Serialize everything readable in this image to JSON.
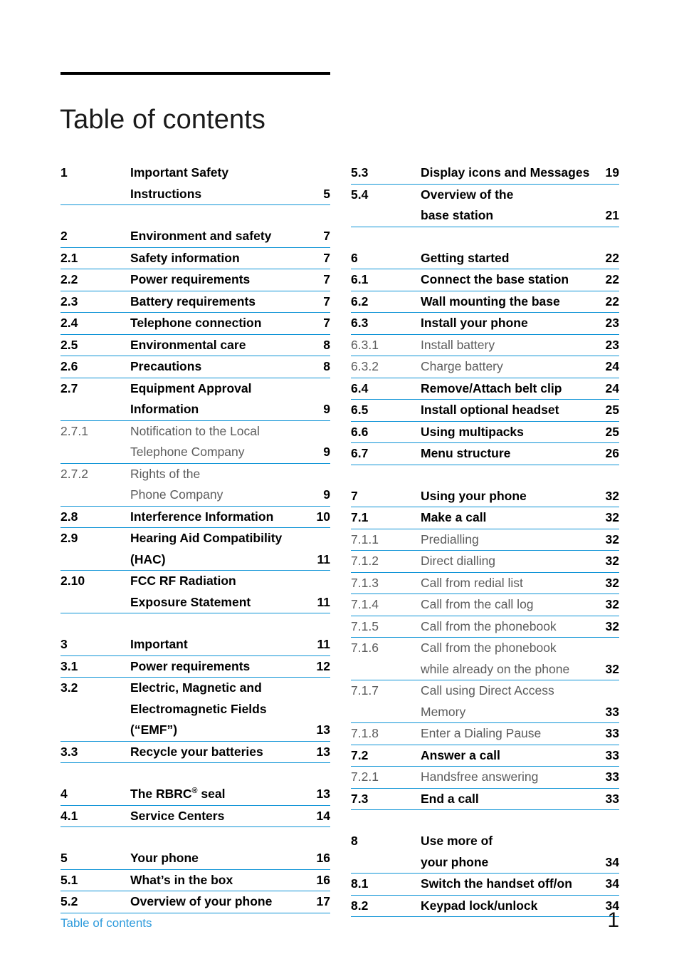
{
  "header": {
    "title": "Table of contents"
  },
  "footer": {
    "label": "Table of contents",
    "page_number": "1"
  },
  "colors": {
    "rule_blue": "#0d93d6",
    "footer_blue": "#2e9bdc",
    "level3_gray": "#5c5c5c",
    "header_rule": "#000000"
  },
  "columns": {
    "left": [
      {
        "group": 1,
        "entries": [
          {
            "level": 1,
            "number": "1",
            "lines": [
              "Important Safety",
              "Instructions"
            ],
            "page": "5"
          }
        ]
      },
      {
        "group": 2,
        "entries": [
          {
            "level": 1,
            "number": "2",
            "lines": [
              "Environment and safety"
            ],
            "page": "7",
            "tight": true
          },
          {
            "level": 2,
            "number": "2.1",
            "lines": [
              "Safety information"
            ],
            "page": "7"
          },
          {
            "level": 2,
            "number": "2.2",
            "lines": [
              "Power requirements"
            ],
            "page": "7"
          },
          {
            "level": 2,
            "number": "2.3",
            "lines": [
              "Battery requirements"
            ],
            "page": "7"
          },
          {
            "level": 2,
            "number": "2.4",
            "lines": [
              "Telephone connection"
            ],
            "page": "7"
          },
          {
            "level": 2,
            "number": "2.5",
            "lines": [
              "Environmental care"
            ],
            "page": "8"
          },
          {
            "level": 2,
            "number": "2.6",
            "lines": [
              "Precautions"
            ],
            "page": "8"
          },
          {
            "level": 2,
            "number": "2.7",
            "lines": [
              "Equipment Approval",
              "Information"
            ],
            "page": "9"
          },
          {
            "level": 3,
            "number": "2.7.1",
            "lines": [
              "Notification to the Local",
              "Telephone Company"
            ],
            "page": "9"
          },
          {
            "level": 3,
            "number": "2.7.2",
            "lines": [
              "Rights of the",
              "Phone Company"
            ],
            "page": "9"
          },
          {
            "level": 2,
            "number": "2.8",
            "lines": [
              "Interference Information"
            ],
            "page": "10"
          },
          {
            "level": 2,
            "number": "2.9",
            "lines": [
              "Hearing Aid Compatibility",
              "(HAC)"
            ],
            "page": "11"
          },
          {
            "level": 2,
            "number": "2.10",
            "lines": [
              "FCC RF Radiation",
              "Exposure Statement"
            ],
            "page": "11"
          }
        ]
      },
      {
        "group": 3,
        "entries": [
          {
            "level": 1,
            "number": "3",
            "lines": [
              "Important"
            ],
            "page": "11"
          },
          {
            "level": 2,
            "number": "3.1",
            "lines": [
              "Power requirements"
            ],
            "page": "12"
          },
          {
            "level": 2,
            "number": "3.2",
            "lines": [
              "Electric, Magnetic and",
              "Electromagnetic Fields",
              "(“EMF”)"
            ],
            "page": "13"
          },
          {
            "level": 2,
            "number": "3.3",
            "lines": [
              "Recycle your batteries"
            ],
            "page": "13"
          }
        ]
      },
      {
        "group": 4,
        "entries": [
          {
            "level": 1,
            "number": "4",
            "lines": [
              "The RBRC® seal"
            ],
            "page": "13",
            "has_sup": true
          },
          {
            "level": 2,
            "number": "4.1",
            "lines": [
              "Service Centers"
            ],
            "page": "14"
          }
        ]
      },
      {
        "group": 5,
        "entries": [
          {
            "level": 1,
            "number": "5",
            "lines": [
              "Your phone"
            ],
            "page": "16"
          },
          {
            "level": 2,
            "number": "5.1",
            "lines": [
              "What’s in the box"
            ],
            "page": "16"
          },
          {
            "level": 2,
            "number": "5.2",
            "lines": [
              "Overview of your phone"
            ],
            "page": "17"
          }
        ]
      }
    ],
    "right": [
      {
        "group": 6,
        "entries": [
          {
            "level": 2,
            "number": "5.3",
            "lines": [
              "Display icons and Messages"
            ],
            "page": "19",
            "tight": true
          },
          {
            "level": 2,
            "number": "5.4",
            "lines": [
              "Overview of the",
              "base station"
            ],
            "page": "21"
          }
        ]
      },
      {
        "group": 7,
        "entries": [
          {
            "level": 1,
            "number": "6",
            "lines": [
              "Getting started"
            ],
            "page": "22"
          },
          {
            "level": 2,
            "number": "6.1",
            "lines": [
              "Connect the base station"
            ],
            "page": "22"
          },
          {
            "level": 2,
            "number": "6.2",
            "lines": [
              "Wall mounting the base"
            ],
            "page": "22"
          },
          {
            "level": 2,
            "number": "6.3",
            "lines": [
              "Install your phone"
            ],
            "page": "23"
          },
          {
            "level": 3,
            "number": "6.3.1",
            "lines": [
              "Install battery"
            ],
            "page": "23"
          },
          {
            "level": 3,
            "number": "6.3.2",
            "lines": [
              "Charge battery"
            ],
            "page": "24"
          },
          {
            "level": 2,
            "number": "6.4",
            "lines": [
              "Remove/Attach belt clip"
            ],
            "page": "24"
          },
          {
            "level": 2,
            "number": "6.5",
            "lines": [
              "Install optional headset"
            ],
            "page": "25"
          },
          {
            "level": 2,
            "number": "6.6",
            "lines": [
              "Using multipacks"
            ],
            "page": "25"
          },
          {
            "level": 2,
            "number": "6.7",
            "lines": [
              "Menu structure"
            ],
            "page": "26"
          }
        ]
      },
      {
        "group": 8,
        "entries": [
          {
            "level": 1,
            "number": "7",
            "lines": [
              "Using your phone"
            ],
            "page": "32"
          },
          {
            "level": 2,
            "number": "7.1",
            "lines": [
              "Make a call"
            ],
            "page": "32"
          },
          {
            "level": 3,
            "number": "7.1.1",
            "lines": [
              "Predialling"
            ],
            "page": "32"
          },
          {
            "level": 3,
            "number": "7.1.2",
            "lines": [
              "Direct dialling"
            ],
            "page": "32"
          },
          {
            "level": 3,
            "number": "7.1.3",
            "lines": [
              "Call from redial list"
            ],
            "page": "32"
          },
          {
            "level": 3,
            "number": "7.1.4",
            "lines": [
              "Call from the call log"
            ],
            "page": "32"
          },
          {
            "level": 3,
            "number": "7.1.5",
            "lines": [
              "Call from the phonebook"
            ],
            "page": "32"
          },
          {
            "level": 3,
            "number": "7.1.6",
            "lines": [
              "Call from the phonebook",
              "while already on the phone"
            ],
            "page": "32",
            "tight": true
          },
          {
            "level": 3,
            "number": "7.1.7",
            "lines": [
              "Call using Direct Access",
              "Memory"
            ],
            "page": "33"
          },
          {
            "level": 3,
            "number": "7.1.8",
            "lines": [
              "Enter a Dialing Pause"
            ],
            "page": "33"
          },
          {
            "level": 2,
            "number": "7.2",
            "lines": [
              "Answer a call"
            ],
            "page": "33"
          },
          {
            "level": 3,
            "number": "7.2.1",
            "lines": [
              "Handsfree answering"
            ],
            "page": "33"
          },
          {
            "level": 2,
            "number": "7.3",
            "lines": [
              "End a call"
            ],
            "page": "33"
          }
        ]
      },
      {
        "group": 9,
        "entries": [
          {
            "level": 1,
            "number": "8",
            "lines": [
              "Use more of",
              "your phone"
            ],
            "page": "34"
          },
          {
            "level": 2,
            "number": "8.1",
            "lines": [
              "Switch the handset off/on"
            ],
            "page": "34",
            "tight": true
          },
          {
            "level": 2,
            "number": "8.2",
            "lines": [
              "Keypad lock/unlock"
            ],
            "page": "34"
          }
        ]
      }
    ]
  }
}
